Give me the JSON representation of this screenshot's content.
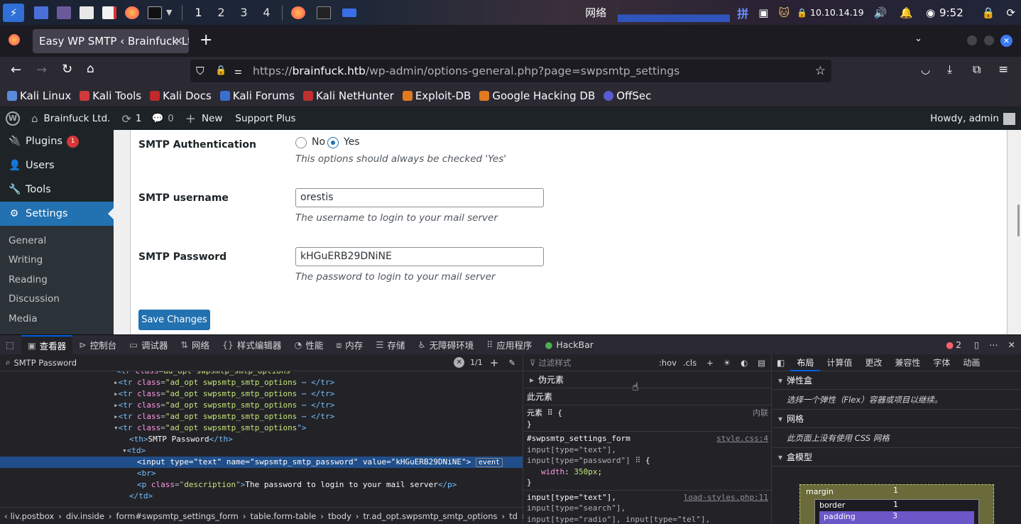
{
  "taskbar": {
    "workspaces": [
      "1",
      "2",
      "3",
      "4"
    ],
    "network_label": "网络",
    "ime_label": "拼",
    "ip": "10.10.14.19",
    "clock": "9:52"
  },
  "browser": {
    "tab_title": "Easy WP SMTP ‹ Brainfuck Lt",
    "url_prefix": "https://",
    "url_domain": "brainfuck.htb",
    "url_path": "/wp-admin/options-general.php?page=swpsmtp_settings",
    "bookmarks": [
      "Kali Linux",
      "Kali Tools",
      "Kali Docs",
      "Kali Forums",
      "Kali NetHunter",
      "Exploit-DB",
      "Google Hacking DB",
      "OffSec"
    ]
  },
  "wp_admin_bar": {
    "site_name": "Brainfuck Ltd.",
    "updates_count": "1",
    "comments_count": "0",
    "new_label": "New",
    "support_label": "Support Plus",
    "greeting": "Howdy, admin"
  },
  "sidebar": {
    "items": [
      {
        "label": "Plugins",
        "badge": "1"
      },
      {
        "label": "Users"
      },
      {
        "label": "Tools"
      },
      {
        "label": "Settings"
      }
    ],
    "subitems": [
      "General",
      "Writing",
      "Reading",
      "Discussion",
      "Media"
    ]
  },
  "form": {
    "auth_label": "SMTP Authentication",
    "auth_no": "No",
    "auth_yes": "Yes",
    "auth_selected": "Yes",
    "auth_desc": "This options should always be checked 'Yes'",
    "username_label": "SMTP username",
    "username_value": "orestis",
    "username_desc": "The username to login to your mail server",
    "password_label": "SMTP Password",
    "password_value": "kHGuERB29DNiNE",
    "password_desc": "The password to login to your mail server",
    "save_label": "Save Changes"
  },
  "devtools": {
    "tabs": [
      "查看器",
      "控制台",
      "调试器",
      "网络",
      "样式编辑器",
      "性能",
      "内存",
      "存储",
      "无障碍环境",
      "应用程序",
      "HackBar"
    ],
    "error_count": "2",
    "search_value": "SMTP Password",
    "search_count": "1/1",
    "markup": {
      "row_class": "ad_opt swpsmtp_smtp_options",
      "th_text": "SMTP Password",
      "input_type": "text",
      "input_name": "swpsmtp_smtp_password",
      "input_value": "kHGuERB29DNiNE",
      "event_badge": "event",
      "p_class": "description",
      "p_text": "The password to login to your mail server"
    },
    "breadcrumbs": [
      "liv.postbox",
      "div.inside",
      "form#swpsmtp_settings_form",
      "table.form-table",
      "tbody",
      "tr.ad_opt.swpsmtp_smtp_options",
      "td",
      "input"
    ],
    "rules": {
      "filter_placeholder": "过滤样式",
      "hov": ":hov",
      "cls": ".cls",
      "pseudo": "伪元素",
      "this_element": "此元素",
      "element_rule": "元素",
      "inline": "内联",
      "selector1": "#swpsmtp_settings_form",
      "selector1b": "input[type=\"text\"],",
      "selector1c": "input[type=\"password\"]",
      "source1": "style.css:4",
      "prop_name": "width",
      "prop_value": "350px",
      "selector2": "input[type=\"text\"],",
      "selector2b": "input[type=\"search\"],",
      "selector2c": "input[type=\"radio\"], input[type=\"tel\"],",
      "source2": "load-styles.php:11"
    },
    "layout": {
      "tabs": [
        "布局",
        "计算值",
        "更改",
        "兼容性",
        "字体",
        "动画"
      ],
      "flex_title": "弹性盒",
      "flex_desc": "选择一个弹性（Flex）容器或项目以继续。",
      "grid_title": "网格",
      "grid_desc": "此页面上没有使用 CSS 网格",
      "box_title": "盒模型",
      "margin_label": "margin",
      "margin_value": "1",
      "border_label": "border",
      "border_value": "1",
      "padding_label": "padding",
      "padding_value": "3"
    }
  }
}
